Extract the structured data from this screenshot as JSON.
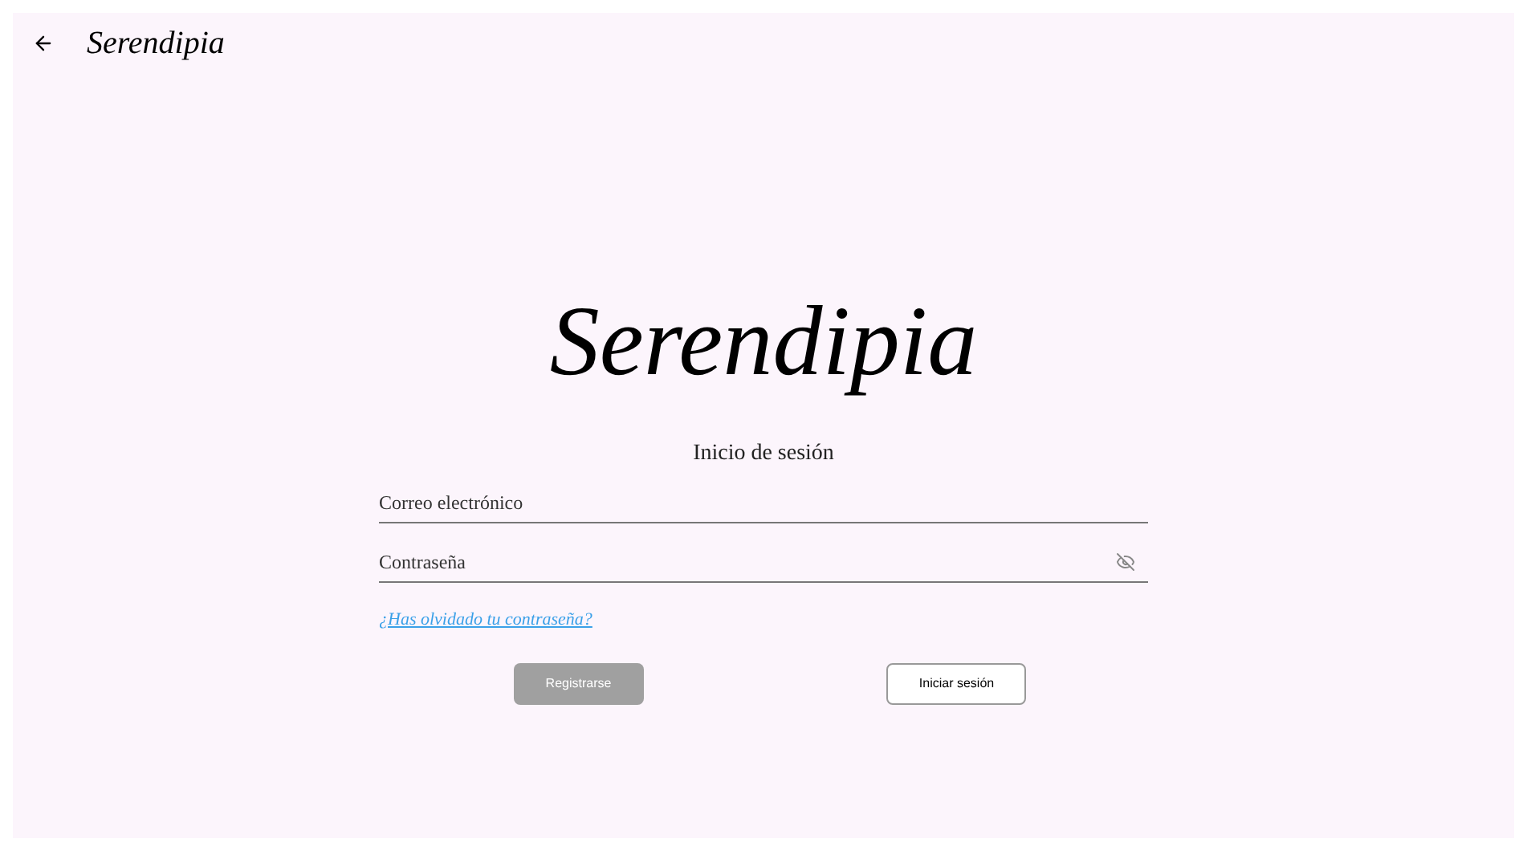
{
  "header": {
    "logo": "Serendipia"
  },
  "logo": "Serendipia",
  "title": "Inicio de sesión",
  "fields": [
    {
      "placeholder": "Correo electrónico",
      "kind": "email"
    },
    {
      "placeholder": "Contraseña",
      "kind": "password"
    }
  ],
  "forgot_link": "¿Has olvidado tu contraseña?",
  "buttons": [
    {
      "label": "Registrarse",
      "disabled": true
    },
    {
      "label": "Iniciar sesión",
      "disabled": false
    }
  ]
}
